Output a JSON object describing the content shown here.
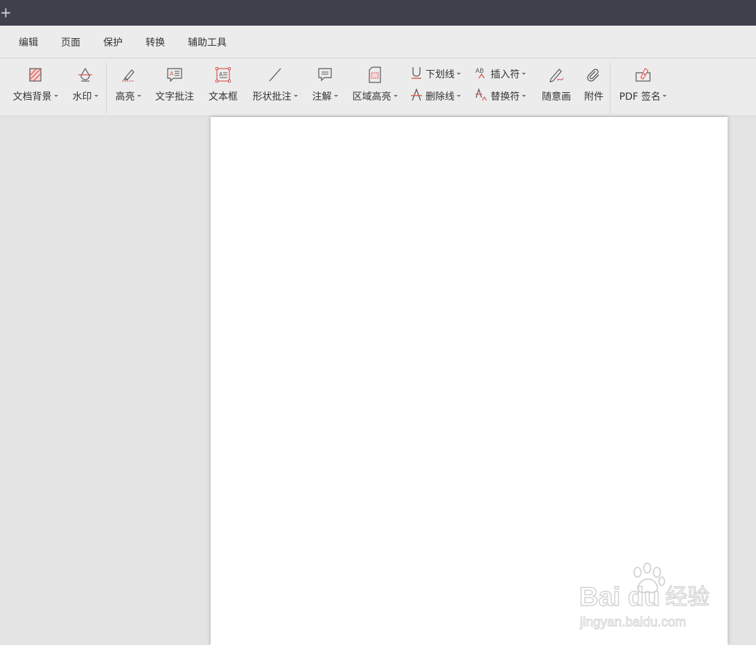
{
  "titlebar": {
    "new_tab_glyph": "+"
  },
  "menu": {
    "items": [
      {
        "label": "编辑"
      },
      {
        "label": "页面"
      },
      {
        "label": "保护"
      },
      {
        "label": "转换"
      },
      {
        "label": "辅助工具"
      }
    ]
  },
  "ribbon": {
    "doc_background": "文档背景",
    "watermark": "水印",
    "highlight": "高亮",
    "text_comment": "文字批注",
    "text_box": "文本框",
    "shape_comment": "形状批注",
    "note": "注解",
    "area_highlight": "区域高亮",
    "underline": "下划线",
    "strikethrough": "删除线",
    "insert_mark": "插入符",
    "replace_mark": "替换符",
    "freehand": "随意画",
    "attachment": "附件",
    "pdf_sign": "PDF 签名"
  },
  "watermark_overlay": {
    "brand_latin": "Bai",
    "brand_du": "du",
    "brand_cn": "经验",
    "url": "jingyan.baidu.com"
  },
  "colors": {
    "accent_red": "#d9534f",
    "titlebar": "#3e414c",
    "toolbar_bg": "#ececec",
    "workspace": "#e4e4e4"
  }
}
